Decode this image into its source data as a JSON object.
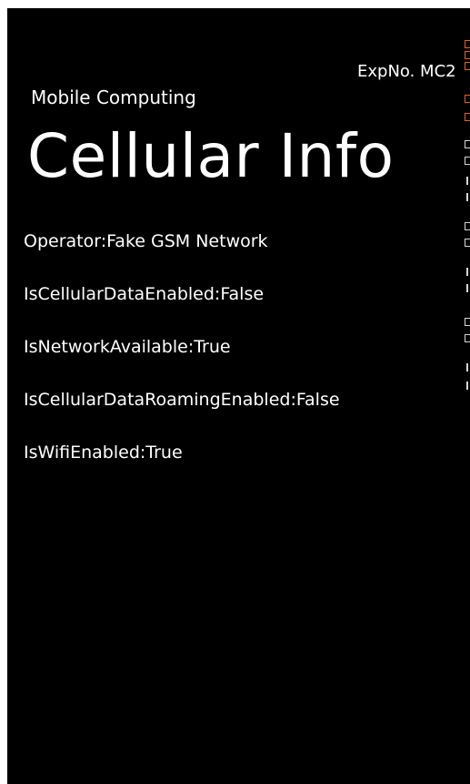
{
  "header": {
    "experiment_label": "ExpNo. MC2",
    "app_title": "Mobile Computing",
    "page_title": "Cellular Info"
  },
  "info_items": [
    {
      "label": "Operator:Fake GSM Network"
    },
    {
      "label": "IsCellularDataEnabled:False"
    },
    {
      "label": "IsNetworkAvailable:True"
    },
    {
      "label": "IsCellularDataRoamingEnabled:False"
    },
    {
      "label": "IsWifiEnabled:True"
    }
  ],
  "colors": {
    "background": "#000000",
    "foreground": "#ffffff",
    "edge_accent": "#e0632a"
  }
}
